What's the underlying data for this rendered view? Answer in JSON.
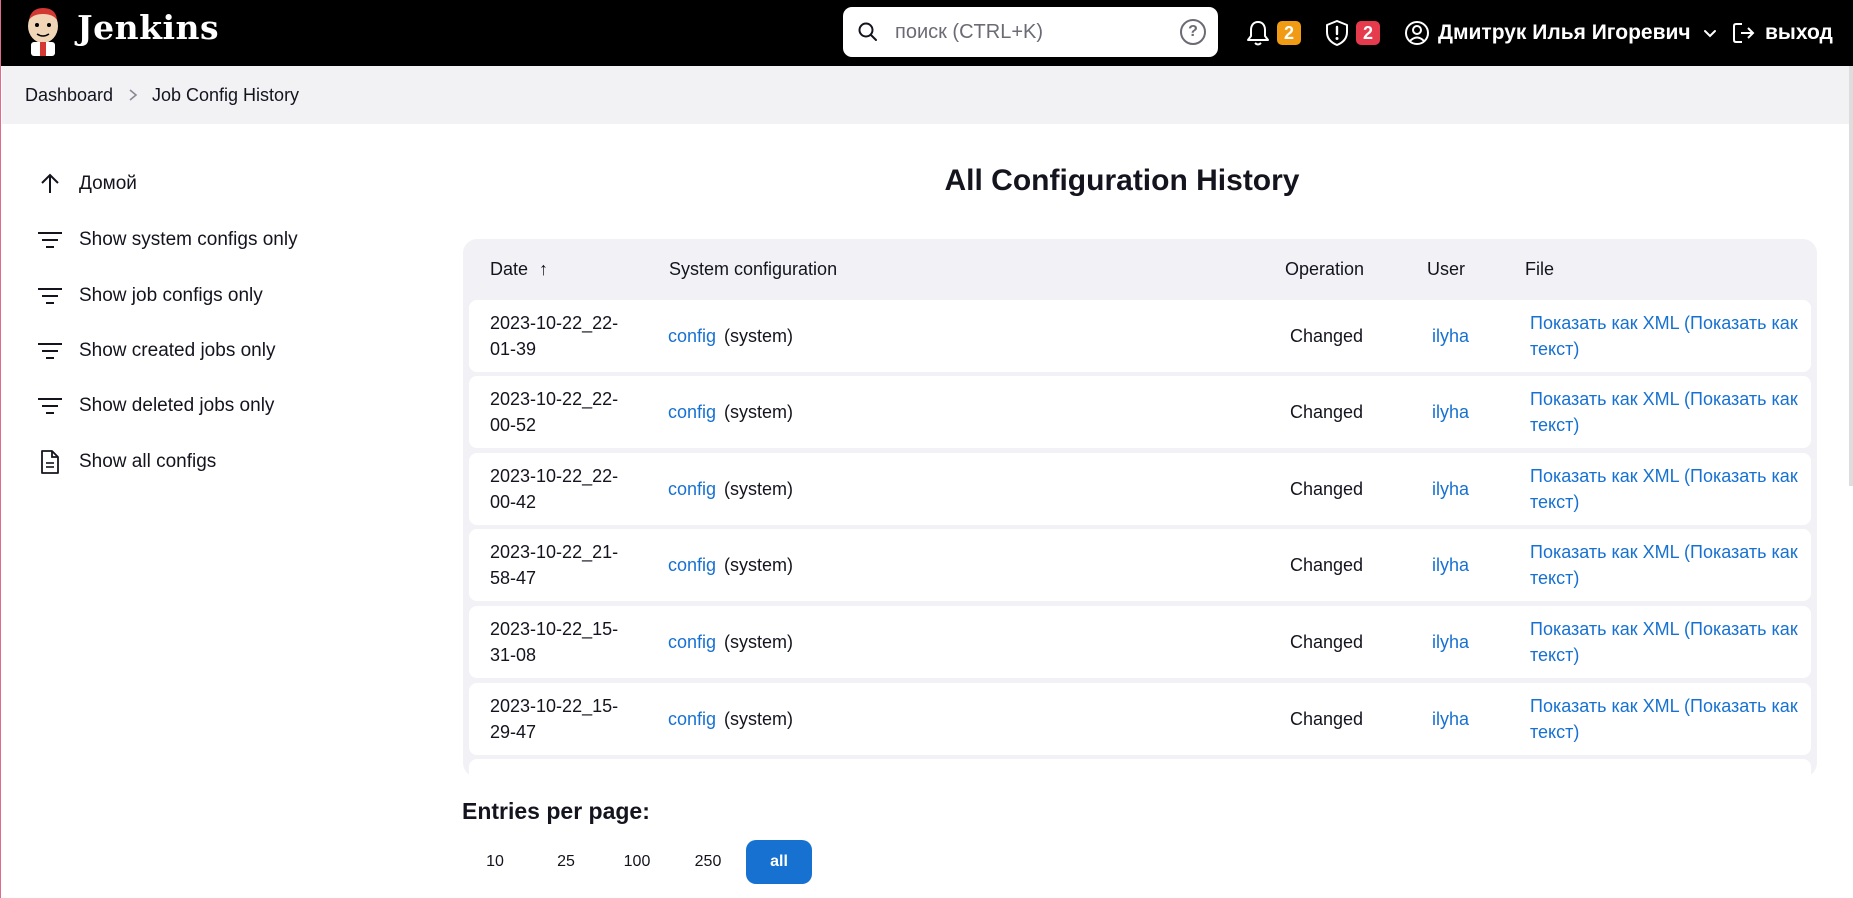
{
  "header": {
    "brand": "Jenkins",
    "search_placeholder": "поиск (CTRL+K)",
    "help_glyph": "?",
    "notifications_count": "2",
    "security_count": "2",
    "user_name": "Дмитрук Илья Игоревич",
    "logout_label": "выход"
  },
  "breadcrumb": {
    "items": [
      "Dashboard",
      "Job Config History"
    ]
  },
  "sidebar": {
    "items": [
      {
        "label": "Домой",
        "icon": "arrow-up-icon"
      },
      {
        "label": "Show system configs only",
        "icon": "filter-icon"
      },
      {
        "label": "Show job configs only",
        "icon": "filter-icon"
      },
      {
        "label": "Show created jobs only",
        "icon": "filter-icon"
      },
      {
        "label": "Show deleted jobs only",
        "icon": "filter-icon"
      },
      {
        "label": "Show all configs",
        "icon": "document-icon"
      }
    ]
  },
  "main": {
    "title": "All Configuration History",
    "table": {
      "columns": [
        "Date",
        "System configuration",
        "Operation",
        "User",
        "File"
      ],
      "sort_indicator": "↑",
      "rows": [
        {
          "date": "2023-10-22_22-01-39",
          "config_link": "config",
          "config_type": "(system)",
          "operation": "Changed",
          "user": "ilyha",
          "file": "Показать как XML (Показать как текст)"
        },
        {
          "date": "2023-10-22_22-00-52",
          "config_link": "config",
          "config_type": "(system)",
          "operation": "Changed",
          "user": "ilyha",
          "file": "Показать как XML (Показать как текст)"
        },
        {
          "date": "2023-10-22_22-00-42",
          "config_link": "config",
          "config_type": "(system)",
          "operation": "Changed",
          "user": "ilyha",
          "file": "Показать как XML (Показать как текст)"
        },
        {
          "date": "2023-10-22_21-58-47",
          "config_link": "config",
          "config_type": "(system)",
          "operation": "Changed",
          "user": "ilyha",
          "file": "Показать как XML (Показать как текст)"
        },
        {
          "date": "2023-10-22_15-31-08",
          "config_link": "config",
          "config_type": "(system)",
          "operation": "Changed",
          "user": "ilyha",
          "file": "Показать как XML (Показать как текст)"
        },
        {
          "date": "2023-10-22_15-29-47",
          "config_link": "config",
          "config_type": "(system)",
          "operation": "Changed",
          "user": "ilyha",
          "file": "Показать как XML (Показать как текст)"
        }
      ]
    },
    "entries_per_page": {
      "label": "Entries per page:",
      "options": [
        "10",
        "25",
        "100",
        "250",
        "all"
      ],
      "selected": "all"
    }
  },
  "colors": {
    "accent": "#1771d1",
    "header_bg": "#000000",
    "notif_badge": "#f19a13",
    "security_badge": "#e53b4c"
  }
}
